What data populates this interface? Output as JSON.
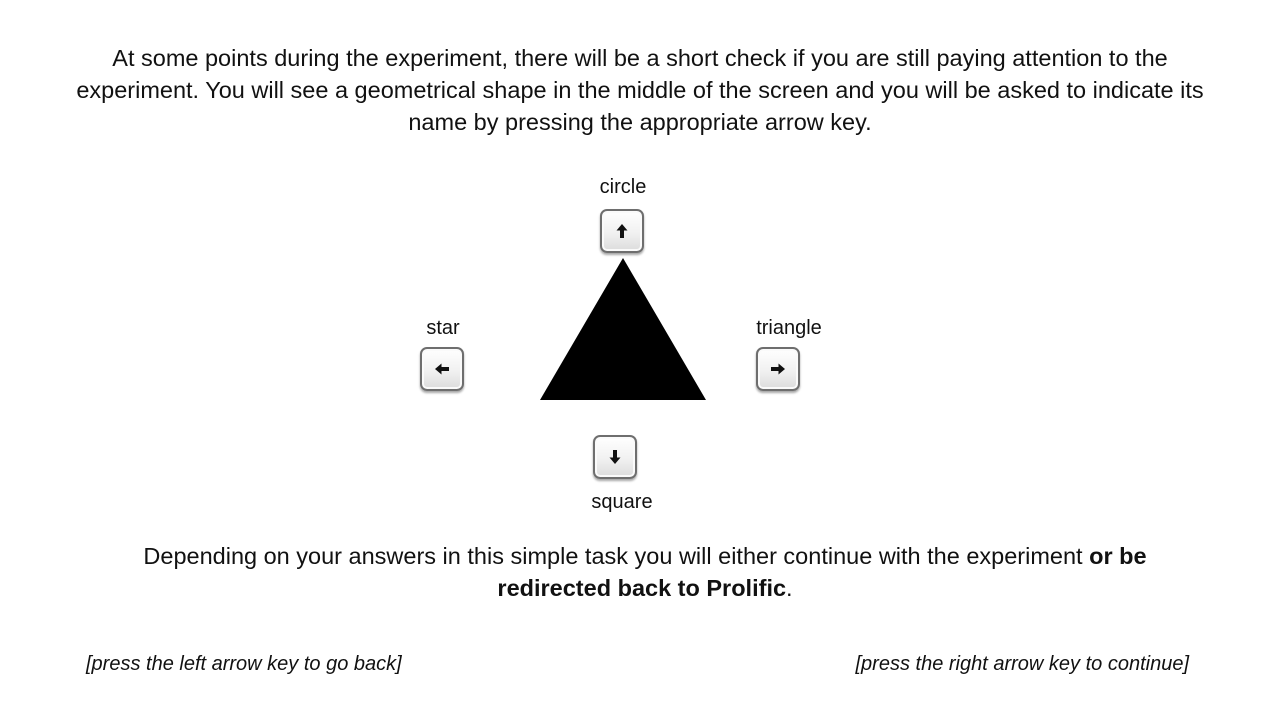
{
  "intro": {
    "text": "At some points during the experiment, there will be a short check if you are still paying attention to the experiment. You will see a geometrical shape in the middle of the screen and you will be asked to indicate its name by pressing the appropriate arrow key."
  },
  "keys": {
    "up": {
      "label": "circle",
      "icon": "arrow-up-icon"
    },
    "left": {
      "label": "star",
      "icon": "arrow-left-icon"
    },
    "right": {
      "label": "triangle",
      "icon": "arrow-right-icon"
    },
    "down": {
      "label": "square",
      "icon": "arrow-down-icon"
    }
  },
  "stimulus": {
    "shape": "triangle",
    "color": "#000000"
  },
  "outcome": {
    "text_start": "Depending on your answers in this simple task you will either continue with the experiment ",
    "text_bold": "or be redirected back to Prolific",
    "text_end": "."
  },
  "navigation": {
    "back_hint": "[press the left arrow key to go back]",
    "continue_hint": "[press the right arrow key to continue]"
  }
}
